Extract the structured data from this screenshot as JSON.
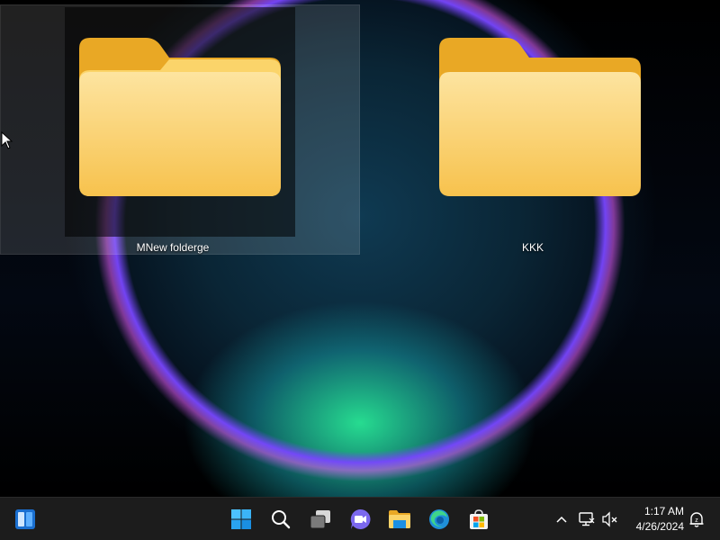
{
  "desktop": {
    "icons": [
      {
        "label": "MNew folderge",
        "icon": "folder-icon",
        "selected": true
      },
      {
        "label": "KKK",
        "icon": "folder-icon",
        "selected": false
      }
    ]
  },
  "taskbar": {
    "left_icons": [
      "widgets-icon"
    ],
    "center_icons": [
      "start-icon",
      "search-icon",
      "task-view-icon",
      "chat-icon",
      "file-explorer-icon",
      "edge-icon",
      "store-icon"
    ],
    "tray_icons": [
      "show-hidden-icons-chevron",
      "network-icon",
      "volume-muted-icon",
      "notification-icon"
    ],
    "time": "1:17 AM",
    "date": "4/26/2024"
  },
  "colors": {
    "taskbar": "#1c1c1c",
    "folder_front": "#fbd46a",
    "folder_back": "#e9a825",
    "accent": "#0078d4"
  }
}
